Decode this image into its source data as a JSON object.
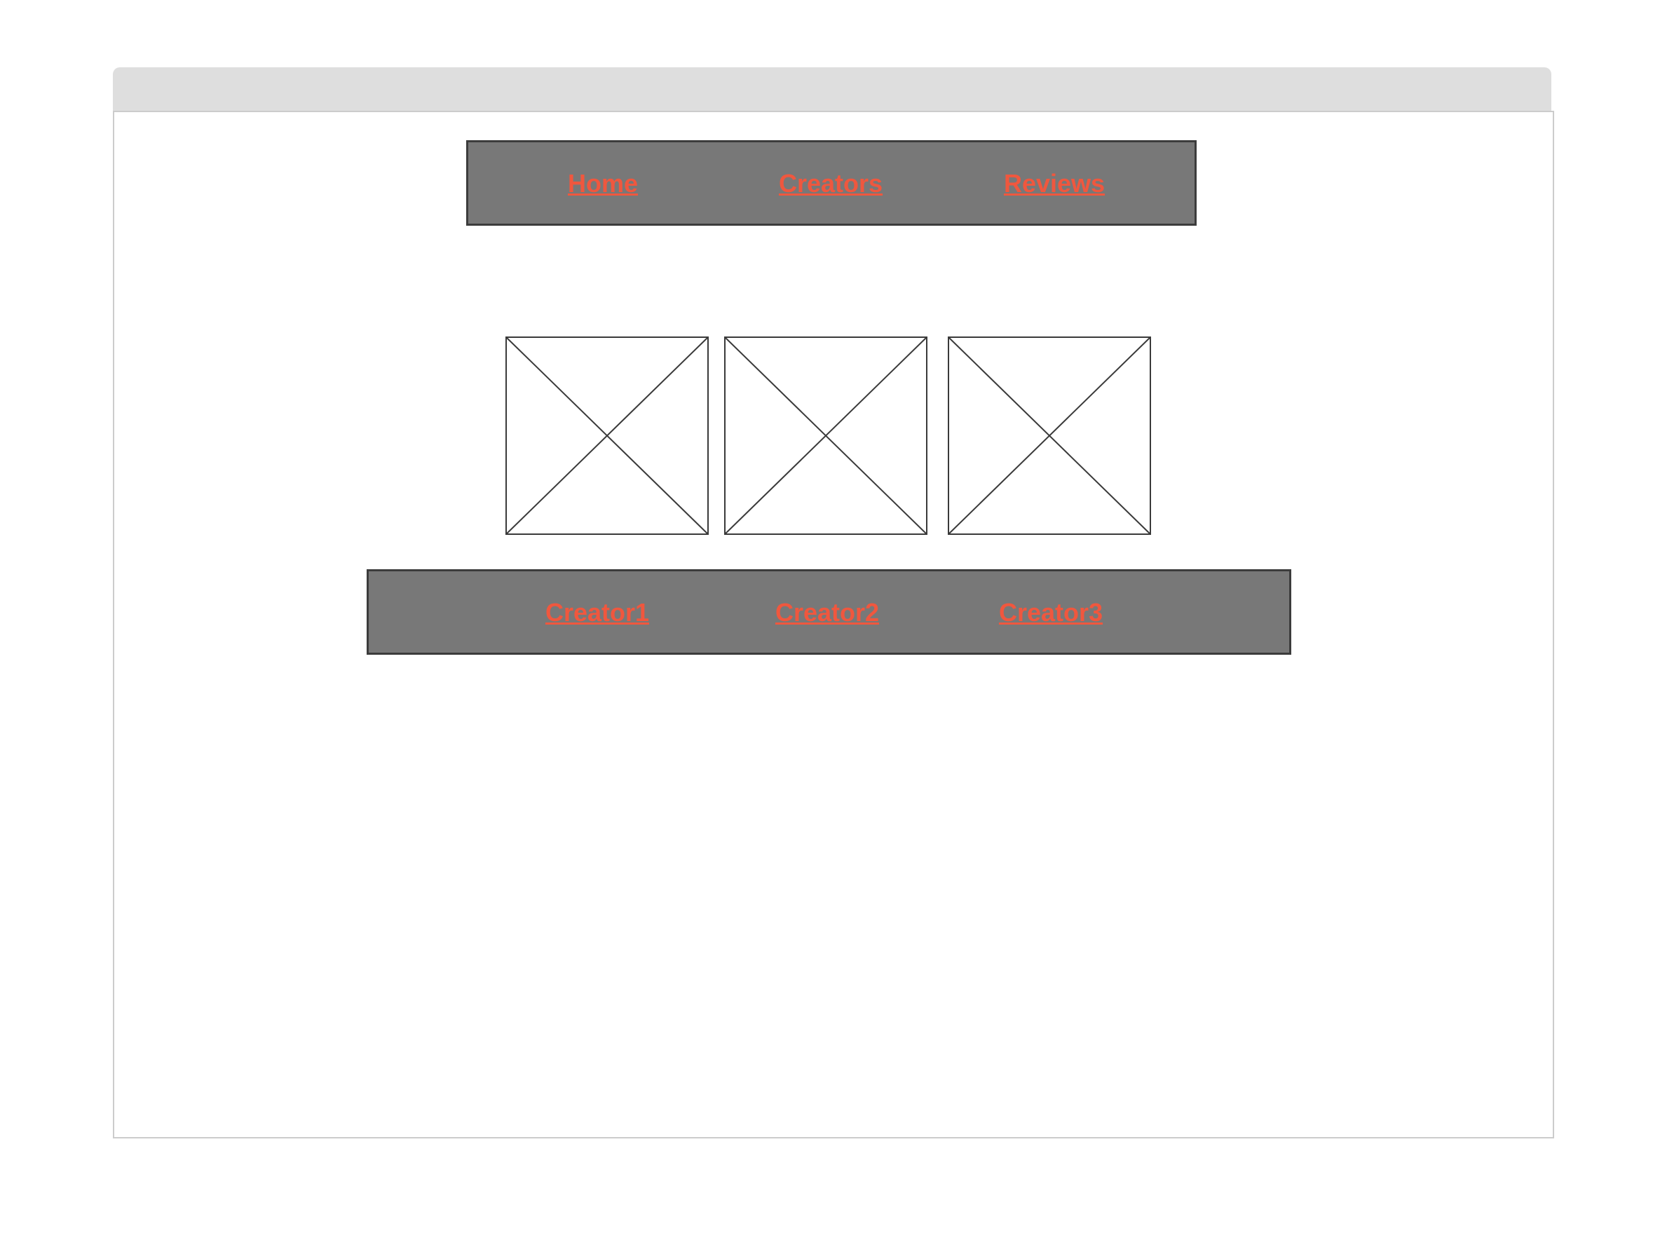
{
  "colors": {
    "link": "#f0573e",
    "nav_background": "#787878",
    "nav_border": "#3c3c3c",
    "titlebar": "#dedede"
  },
  "top_nav": {
    "items": [
      {
        "label": "Home"
      },
      {
        "label": "Creators"
      },
      {
        "label": "Reviews"
      }
    ]
  },
  "gallery": {
    "images": [
      {
        "icon": "image-placeholder-icon"
      },
      {
        "icon": "image-placeholder-icon"
      },
      {
        "icon": "image-placeholder-icon"
      }
    ]
  },
  "creator_nav": {
    "items": [
      {
        "label": "Creator1"
      },
      {
        "label": "Creator2"
      },
      {
        "label": "Creator3"
      }
    ]
  }
}
